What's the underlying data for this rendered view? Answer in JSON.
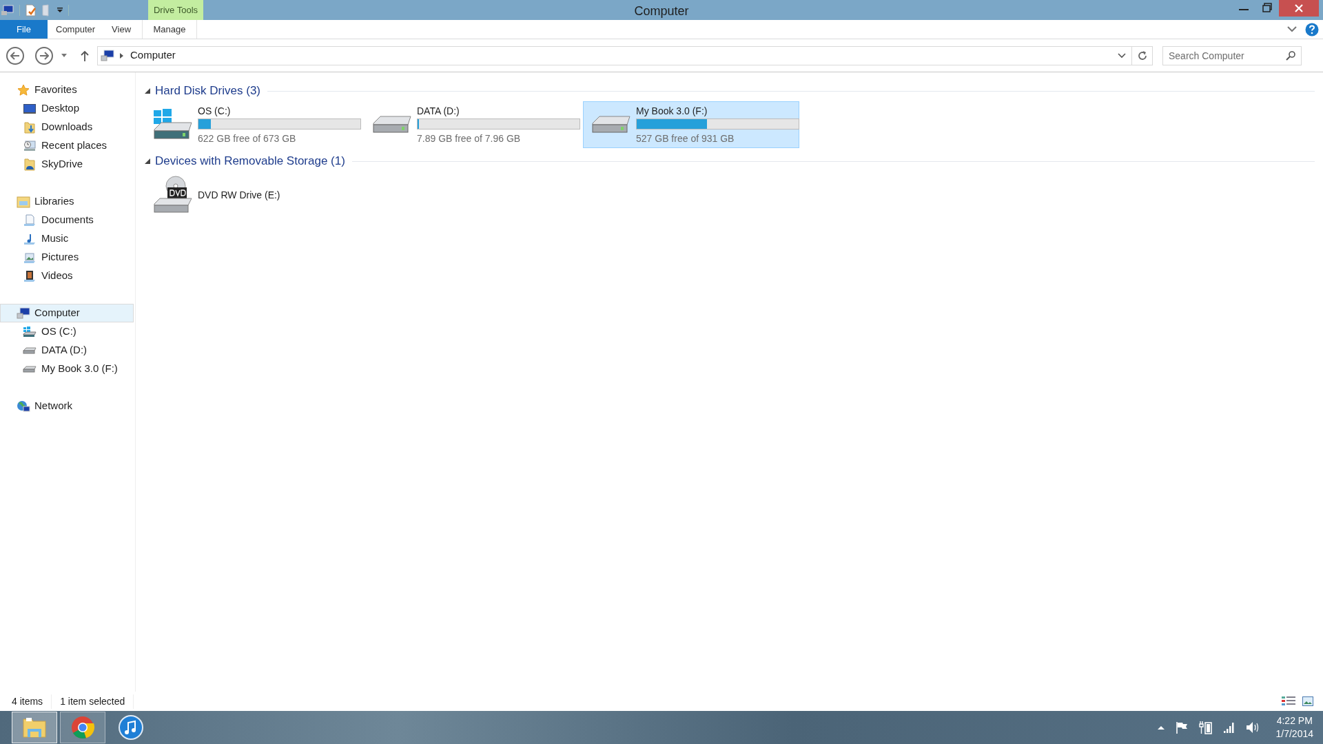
{
  "title_bar": {
    "context_tab": "Drive Tools",
    "title": "Computer"
  },
  "ribbon_tabs": [
    {
      "label": "File",
      "kind": "file"
    },
    {
      "label": "Computer",
      "kind": "tab"
    },
    {
      "label": "View",
      "kind": "tab"
    },
    {
      "label": "Manage",
      "kind": "context"
    }
  ],
  "address_bar": {
    "location": "Computer"
  },
  "search": {
    "placeholder": "Search Computer"
  },
  "sidebar": [
    {
      "label": "Favorites",
      "selected": false,
      "children": [
        {
          "label": "Desktop",
          "selected": false
        },
        {
          "label": "Downloads",
          "selected": false
        },
        {
          "label": "Recent places",
          "selected": false
        },
        {
          "label": "SkyDrive",
          "selected": false
        }
      ]
    },
    {
      "label": "Libraries",
      "selected": false,
      "children": [
        {
          "label": "Documents",
          "selected": false
        },
        {
          "label": "Music",
          "selected": false
        },
        {
          "label": "Pictures",
          "selected": false
        },
        {
          "label": "Videos",
          "selected": false
        }
      ]
    },
    {
      "label": "Computer",
      "selected": true,
      "children": [
        {
          "label": "OS (C:)",
          "selected": false
        },
        {
          "label": "DATA (D:)",
          "selected": false
        },
        {
          "label": "My Book 3.0 (F:)",
          "selected": false
        }
      ]
    },
    {
      "label": "Network",
      "selected": false
    }
  ],
  "sections": [
    {
      "title": "Hard Disk Drives (3)",
      "expanded": true,
      "items": [
        {
          "name": "OS (C:)",
          "kind": "system",
          "level": 0.076,
          "free": "622 GB free of 673 GB",
          "selected": false
        },
        {
          "name": "DATA (D:)",
          "kind": "drive",
          "level": 0.01,
          "free": "7.89 GB free of 7.96 GB",
          "selected": false
        },
        {
          "name": "My Book 3.0 (F:)",
          "kind": "drive",
          "level": 0.434,
          "free": "527 GB free of 931 GB",
          "selected": true
        }
      ]
    },
    {
      "title": "Devices with Removable Storage (1)",
      "expanded": true,
      "items": [
        {
          "name": "DVD RW Drive (E:)",
          "kind": "dvd",
          "selected": false
        }
      ]
    }
  ],
  "status_bar": {
    "count": "4 items",
    "selection": "1 item selected"
  },
  "taskbar": {
    "apps": [
      {
        "kind": "explorer",
        "selected": true
      },
      {
        "kind": "chrome",
        "selected": false
      },
      {
        "kind": "itunes",
        "selected": false
      }
    ],
    "time": "4:22 PM",
    "date": "1/7/2014"
  }
}
